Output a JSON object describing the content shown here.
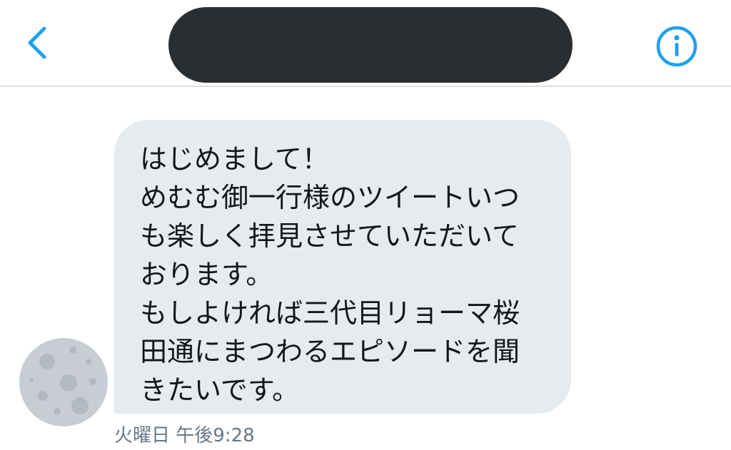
{
  "header": {
    "back_icon": "chevron-left-icon",
    "info_icon": "info-circle-icon",
    "accent_color": "#1da1f2"
  },
  "conversation": {
    "message": {
      "lines": [
        "はじめまして！",
        "めむむ御一行様のツイートいつ",
        "も楽しく拝見させていただいて",
        "おります。",
        "もしよければ三代目リョーマ桜",
        "田通にまつわるエピソードを聞",
        "きたいです。"
      ],
      "timestamp": "火曜日 午後9:28"
    },
    "avatar_icon": "moon-avatar-icon"
  }
}
